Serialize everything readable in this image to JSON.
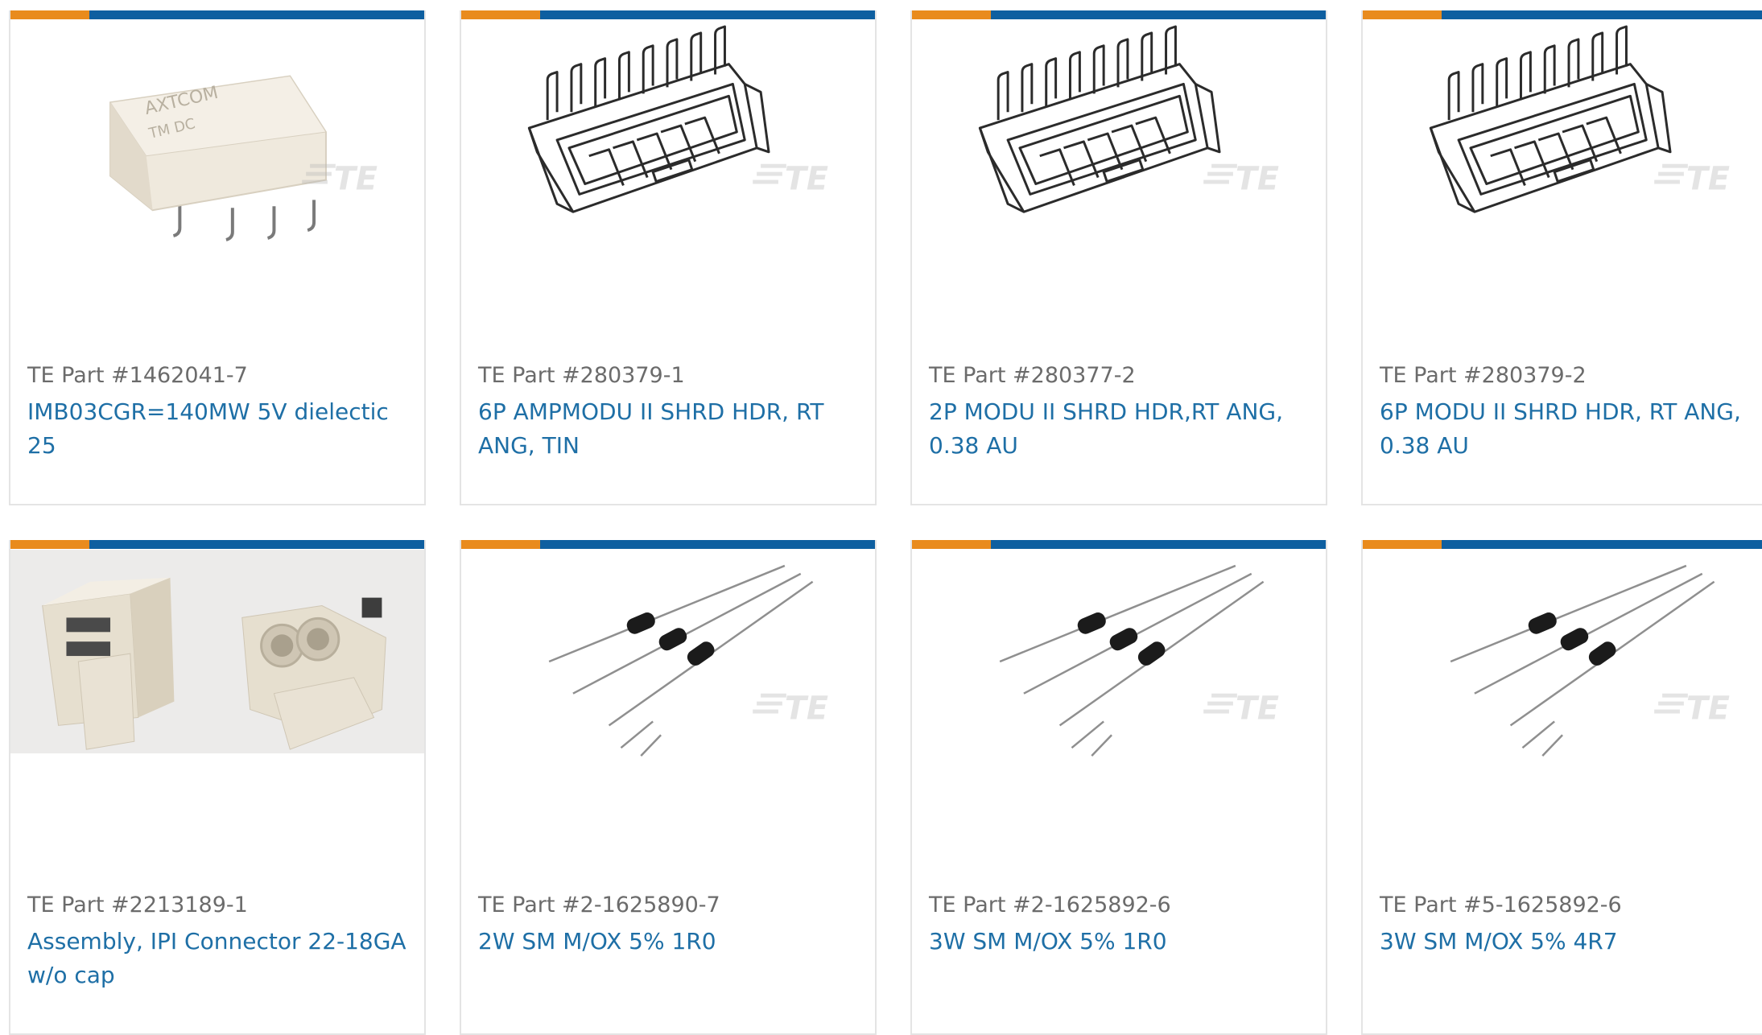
{
  "colors": {
    "accent_orange": "#e98b1d",
    "accent_blue": "#0e5fa0",
    "link_blue": "#1e6fa6",
    "muted_text": "#6b6b6b",
    "card_border": "#e4e4e4"
  },
  "watermark": "TE",
  "cards": [
    {
      "part_number": "TE Part #1462041-7",
      "title": "IMB03CGR=140MW 5V dielectic 25",
      "image": "relay-image"
    },
    {
      "part_number": "TE Part #280379-1",
      "title": "6P AMPMODU II SHRD HDR, RT ANG, TIN",
      "image": "header-connector-image"
    },
    {
      "part_number": "TE Part #280377-2",
      "title": "2P MODU II SHRD HDR,RT ANG, 0.38 AU",
      "image": "header-connector-image"
    },
    {
      "part_number": "TE Part #280379-2",
      "title": "6P MODU II SHRD HDR, RT ANG, 0.38 AU",
      "image": "header-connector-image"
    },
    {
      "part_number": "TE Part #2213189-1",
      "title": "Assembly, IPI Connector 22-18GA w/o cap",
      "image": "ipi-connector-image"
    },
    {
      "part_number": "TE Part #2-1625890-7",
      "title": "2W SM M/OX 5% 1R0",
      "image": "resistor-image"
    },
    {
      "part_number": "TE Part #2-1625892-6",
      "title": "3W SM M/OX 5% 1R0",
      "image": "resistor-image"
    },
    {
      "part_number": "TE Part #5-1625892-6",
      "title": "3W SM M/OX 5% 4R7",
      "image": "resistor-image"
    }
  ]
}
